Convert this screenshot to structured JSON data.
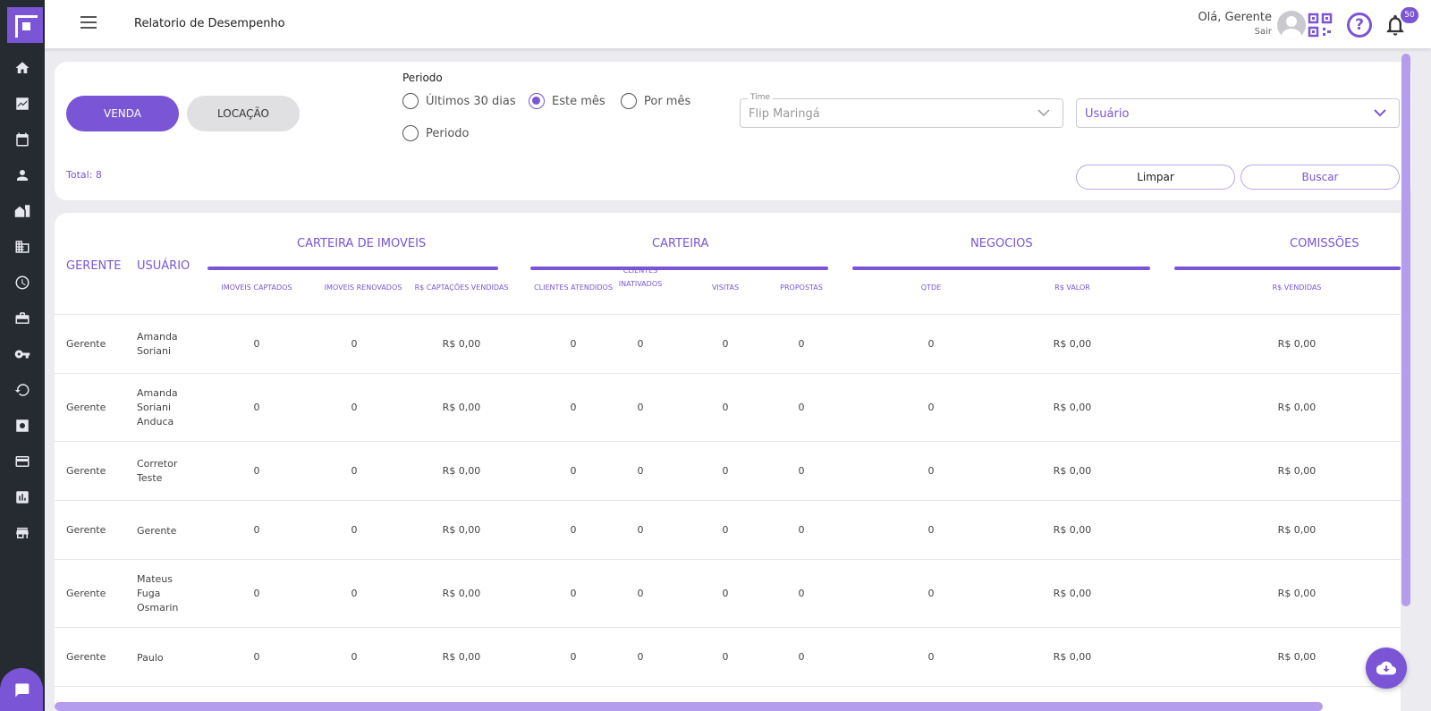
{
  "header": {
    "title": "Relatorio de Desempenho",
    "greeting": "Olá, Gerente",
    "logout": "Sair",
    "notification_count": "50"
  },
  "sidebar": {
    "icons": [
      "home-icon",
      "trending-icon",
      "calendar-icon",
      "person-icon",
      "buildings-icon",
      "building-icon",
      "clock-icon",
      "briefcase-icon",
      "key-icon",
      "refresh-icon",
      "settings-box-icon",
      "card-icon",
      "chart-icon",
      "store-icon"
    ]
  },
  "filter": {
    "venda_label": "VENDA",
    "locacao_label": "LOCAÇÃO",
    "periodo_title": "Periodo",
    "radio_30": "Últimos 30 dias",
    "radio_mes": "Este mês",
    "radio_pormes": "Por mês",
    "radio_periodo": "Periodo",
    "time_legend": "Time",
    "time_value": "Flip Maringá",
    "usuario_placeholder": "Usuário",
    "total": "Total: 8",
    "limpar": "Limpar",
    "buscar": "Buscar"
  },
  "table": {
    "gerente_header": "GERENTE",
    "usuario_header": "USUÁRIO",
    "groups": {
      "carteira_imoveis": "CARTEIRA DE IMOVEIS",
      "carteira": "CARTEIRA",
      "negocios": "NEGOCIOS",
      "comissoes": "COMISSÕES"
    },
    "sub": {
      "imoveis_captados": "IMOVEIS CAPTADOS",
      "imoveis_renovados": "IMOVEIS RENOVADOS",
      "captacoes_vendidas": "R$ CAPTAÇÕES VENDIDAS",
      "clientes_atendidos": "CLIENTES ATENDIDOS",
      "clientes_inativados": "CLIENTES INATIVADOS",
      "visitas": "VISITAS",
      "propostas": "PROPOSTAS",
      "qtde": "QTDE",
      "valor": "R$ VALOR",
      "vendidas": "R$ VENDIDAS"
    },
    "rows": [
      {
        "gerente": "Gerente",
        "usuario": "Amanda Soriani",
        "c1": "0",
        "c2": "0",
        "c3": "R$ 0,00",
        "c4": "0",
        "c5": "0",
        "c6": "0",
        "c7": "0",
        "c8": "0",
        "c9": "R$ 0,00",
        "c10": "R$ 0,00"
      },
      {
        "gerente": "Gerente",
        "usuario": "Amanda Soriani Anduca",
        "c1": "0",
        "c2": "0",
        "c3": "R$ 0,00",
        "c4": "0",
        "c5": "0",
        "c6": "0",
        "c7": "0",
        "c8": "0",
        "c9": "R$ 0,00",
        "c10": "R$ 0,00"
      },
      {
        "gerente": "Gerente",
        "usuario": "Corretor Teste",
        "c1": "0",
        "c2": "0",
        "c3": "R$ 0,00",
        "c4": "0",
        "c5": "0",
        "c6": "0",
        "c7": "0",
        "c8": "0",
        "c9": "R$ 0,00",
        "c10": "R$ 0,00"
      },
      {
        "gerente": "Gerente",
        "usuario": "Gerente",
        "c1": "0",
        "c2": "0",
        "c3": "R$ 0,00",
        "c4": "0",
        "c5": "0",
        "c6": "0",
        "c7": "0",
        "c8": "0",
        "c9": "R$ 0,00",
        "c10": "R$ 0,00"
      },
      {
        "gerente": "Gerente",
        "usuario": "Mateus Fuga Osmarin",
        "c1": "0",
        "c2": "0",
        "c3": "R$ 0,00",
        "c4": "0",
        "c5": "0",
        "c6": "0",
        "c7": "0",
        "c8": "0",
        "c9": "R$ 0,00",
        "c10": "R$ 0,00"
      },
      {
        "gerente": "Gerente",
        "usuario": "Paulo",
        "c1": "0",
        "c2": "0",
        "c3": "R$ 0,00",
        "c4": "0",
        "c5": "0",
        "c6": "0",
        "c7": "0",
        "c8": "0",
        "c9": "R$ 0,00",
        "c10": "R$ 0,00"
      }
    ]
  },
  "colors": {
    "accent": "#7a55d6",
    "sidebar": "#262a31"
  }
}
